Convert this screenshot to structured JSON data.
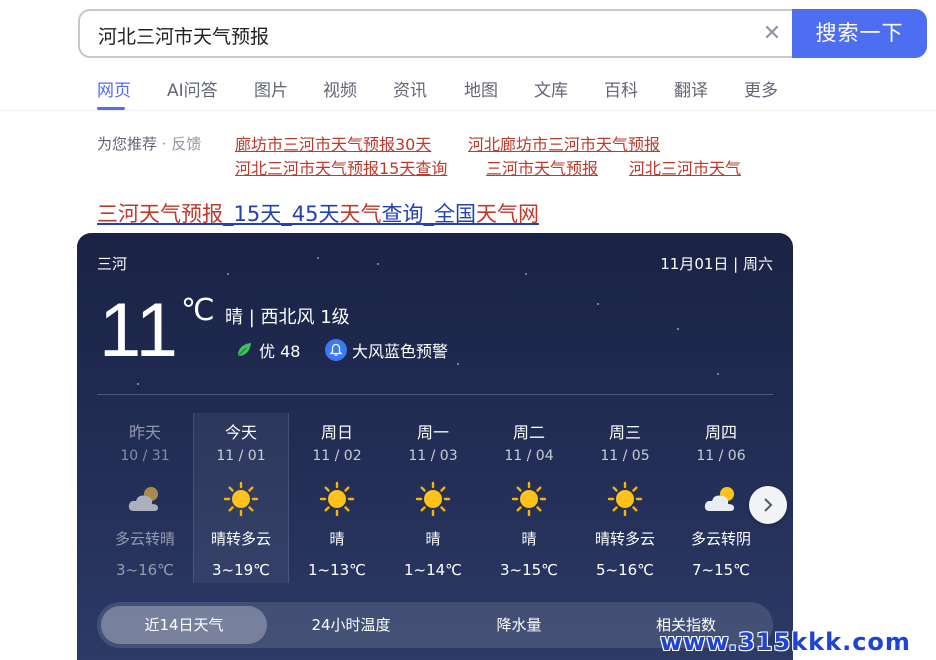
{
  "search": {
    "query": "河北三河市天气预报",
    "button_label": "搜索一下"
  },
  "tabs": [
    {
      "label": "网页",
      "active": true
    },
    {
      "label": "AI问答"
    },
    {
      "label": "图片"
    },
    {
      "label": "视频"
    },
    {
      "label": "资讯"
    },
    {
      "label": "地图"
    },
    {
      "label": "文库"
    },
    {
      "label": "百科"
    },
    {
      "label": "翻译"
    },
    {
      "label": "更多"
    }
  ],
  "recommend": {
    "label": "为您推荐",
    "separator": "·",
    "feedback": "反馈",
    "links": [
      "廊坊市三河市天气预报30天",
      "河北廊坊市三河市天气预报",
      "河北三河市天气预报15天查询",
      "三河市天气预报",
      "河北三河市天气"
    ]
  },
  "result": {
    "title_parts": [
      "三河天气预报",
      "_15天_45天",
      "天气",
      "查询_全国",
      "天气网"
    ]
  },
  "weather": {
    "city": "三河",
    "date": "11月01日 | 周六",
    "temperature": "11",
    "unit": "℃",
    "condition": "晴 | 西北风 1级",
    "aqi": "优 48",
    "alert": "大风蓝色预警",
    "days": [
      {
        "weekday": "昨天",
        "date": "10 / 31",
        "condition": "多云转晴",
        "range": "3~16℃",
        "icon": "cloud-sun-icon",
        "state": "past"
      },
      {
        "weekday": "今天",
        "date": "11 / 01",
        "condition": "晴转多云",
        "range": "3~19℃",
        "icon": "sun-icon",
        "state": "today"
      },
      {
        "weekday": "周日",
        "date": "11 / 02",
        "condition": "晴",
        "range": "1~13℃",
        "icon": "sun-icon"
      },
      {
        "weekday": "周一",
        "date": "11 / 03",
        "condition": "晴",
        "range": "1~14℃",
        "icon": "sun-icon"
      },
      {
        "weekday": "周二",
        "date": "11 / 04",
        "condition": "晴",
        "range": "3~15℃",
        "icon": "sun-icon"
      },
      {
        "weekday": "周三",
        "date": "11 / 05",
        "condition": "晴转多云",
        "range": "5~16℃",
        "icon": "sun-icon"
      },
      {
        "weekday": "周四",
        "date": "11 / 06",
        "condition": "多云转阴",
        "range": "7~15℃",
        "icon": "cloud-sun-icon"
      }
    ],
    "segments": [
      {
        "label": "近14日天气",
        "active": true
      },
      {
        "label": "24小时温度"
      },
      {
        "label": "降水量"
      },
      {
        "label": "相关指数"
      }
    ]
  },
  "watermark": "www.315kkk.com",
  "colors": {
    "accent": "#4e6ef2",
    "link_red": "#c0392b",
    "link_blue": "#2440b3",
    "card_bg": "#222d55",
    "sun": "#f7b500"
  }
}
